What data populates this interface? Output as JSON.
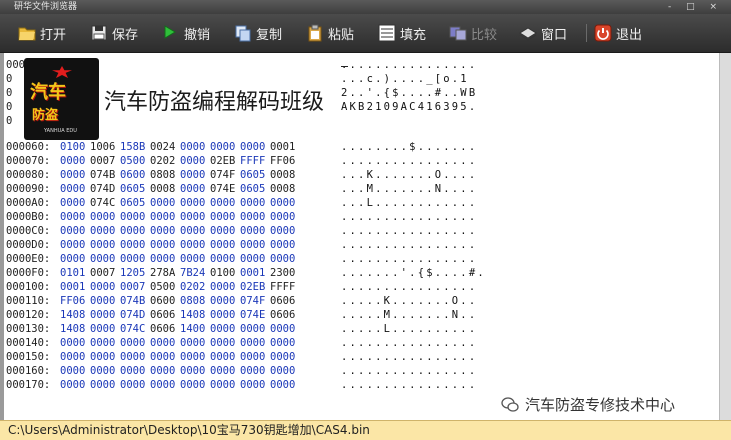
{
  "window": {
    "title": "研华文件浏览器",
    "controls": "- □ ×"
  },
  "toolbar": {
    "open": "打开",
    "save": "保存",
    "undo": "撤销",
    "copy": "复制",
    "paste": "粘贴",
    "fill": "填充",
    "compare": "比较",
    "window": "窗口",
    "exit": "退出"
  },
  "overlay": {
    "title": "汽车防盗编程解码班级",
    "logo_line1": "汽车",
    "logo_line2": "防盗",
    "logo_tag": "YANHUA EDU"
  },
  "hex_rows": [
    {
      "addr": "000060:",
      "words": [
        "0100",
        "1006",
        "158B",
        "0024",
        "0000",
        "0000",
        "0000",
        "0001"
      ],
      "ascii": "........$......."
    },
    {
      "addr": "000070:",
      "words": [
        "0000",
        "0007",
        "0500",
        "0202",
        "0000",
        "02EB",
        "FFFF",
        "FF06"
      ],
      "ascii": "................"
    },
    {
      "addr": "000080:",
      "words": [
        "0000",
        "074B",
        "0600",
        "0808",
        "0000",
        "074F",
        "0605",
        "0008"
      ],
      "ascii": "...K.......O...."
    },
    {
      "addr": "000090:",
      "words": [
        "0000",
        "074D",
        "0605",
        "0008",
        "0000",
        "074E",
        "0605",
        "0008"
      ],
      "ascii": "...M.......N...."
    },
    {
      "addr": "0000A0:",
      "words": [
        "0000",
        "074C",
        "0605",
        "0000",
        "0000",
        "0000",
        "0000",
        "0000"
      ],
      "ascii": "...L............"
    },
    {
      "addr": "0000B0:",
      "words": [
        "0000",
        "0000",
        "0000",
        "0000",
        "0000",
        "0000",
        "0000",
        "0000"
      ],
      "ascii": "................"
    },
    {
      "addr": "0000C0:",
      "words": [
        "0000",
        "0000",
        "0000",
        "0000",
        "0000",
        "0000",
        "0000",
        "0000"
      ],
      "ascii": "................"
    },
    {
      "addr": "0000D0:",
      "words": [
        "0000",
        "0000",
        "0000",
        "0000",
        "0000",
        "0000",
        "0000",
        "0000"
      ],
      "ascii": "................"
    },
    {
      "addr": "0000E0:",
      "words": [
        "0000",
        "0000",
        "0000",
        "0000",
        "0000",
        "0000",
        "0000",
        "0000"
      ],
      "ascii": "................"
    },
    {
      "addr": "0000F0:",
      "words": [
        "0101",
        "0007",
        "1205",
        "278A",
        "7B24",
        "0100",
        "0001",
        "2300"
      ],
      "ascii": ".......'.{$....#."
    },
    {
      "addr": "000100:",
      "words": [
        "0001",
        "0000",
        "0007",
        "0500",
        "0202",
        "0000",
        "02EB",
        "FFFF"
      ],
      "ascii": "................"
    },
    {
      "addr": "000110:",
      "words": [
        "FF06",
        "0000",
        "074B",
        "0600",
        "0808",
        "0000",
        "074F",
        "0606"
      ],
      "ascii": ".....K.......O.."
    },
    {
      "addr": "000120:",
      "words": [
        "1408",
        "0000",
        "074D",
        "0606",
        "1408",
        "0000",
        "074E",
        "0606"
      ],
      "ascii": ".....M.......N.."
    },
    {
      "addr": "000130:",
      "words": [
        "1408",
        "0000",
        "074C",
        "0606",
        "1400",
        "0000",
        "0000",
        "0000"
      ],
      "ascii": ".....L.........."
    },
    {
      "addr": "000140:",
      "words": [
        "0000",
        "0000",
        "0000",
        "0000",
        "0000",
        "0000",
        "0000",
        "0000"
      ],
      "ascii": "................"
    },
    {
      "addr": "000150:",
      "words": [
        "0000",
        "0000",
        "0000",
        "0000",
        "0000",
        "0000",
        "0000",
        "0000"
      ],
      "ascii": "................"
    },
    {
      "addr": "000160:",
      "words": [
        "0000",
        "0000",
        "0000",
        "0000",
        "0000",
        "0000",
        "0000",
        "0000"
      ],
      "ascii": "................"
    },
    {
      "addr": "000170:",
      "words": [
        "0000",
        "0000",
        "0000",
        "0000",
        "0000",
        "0000",
        "0000",
        "0000"
      ],
      "ascii": "................"
    }
  ],
  "top_ascii": [
    "................",
    "...c.)...._[o.1",
    "2..'.{$....#..WB",
    "AKB2109AC416395."
  ],
  "top_addr_stub": [
    "000",
    "0",
    "0",
    "0",
    "0"
  ],
  "watermark": "汽车防盗专修技术中心",
  "status": {
    "path": "C:\\Users\\Administrator\\Desktop\\10宝马730钥匙增加\\CAS4.bin"
  },
  "colors": {
    "hex_blue": "#1a37b8",
    "status_bg": "#fbe6a6",
    "toolbar_bg": "#2c2c2c"
  }
}
